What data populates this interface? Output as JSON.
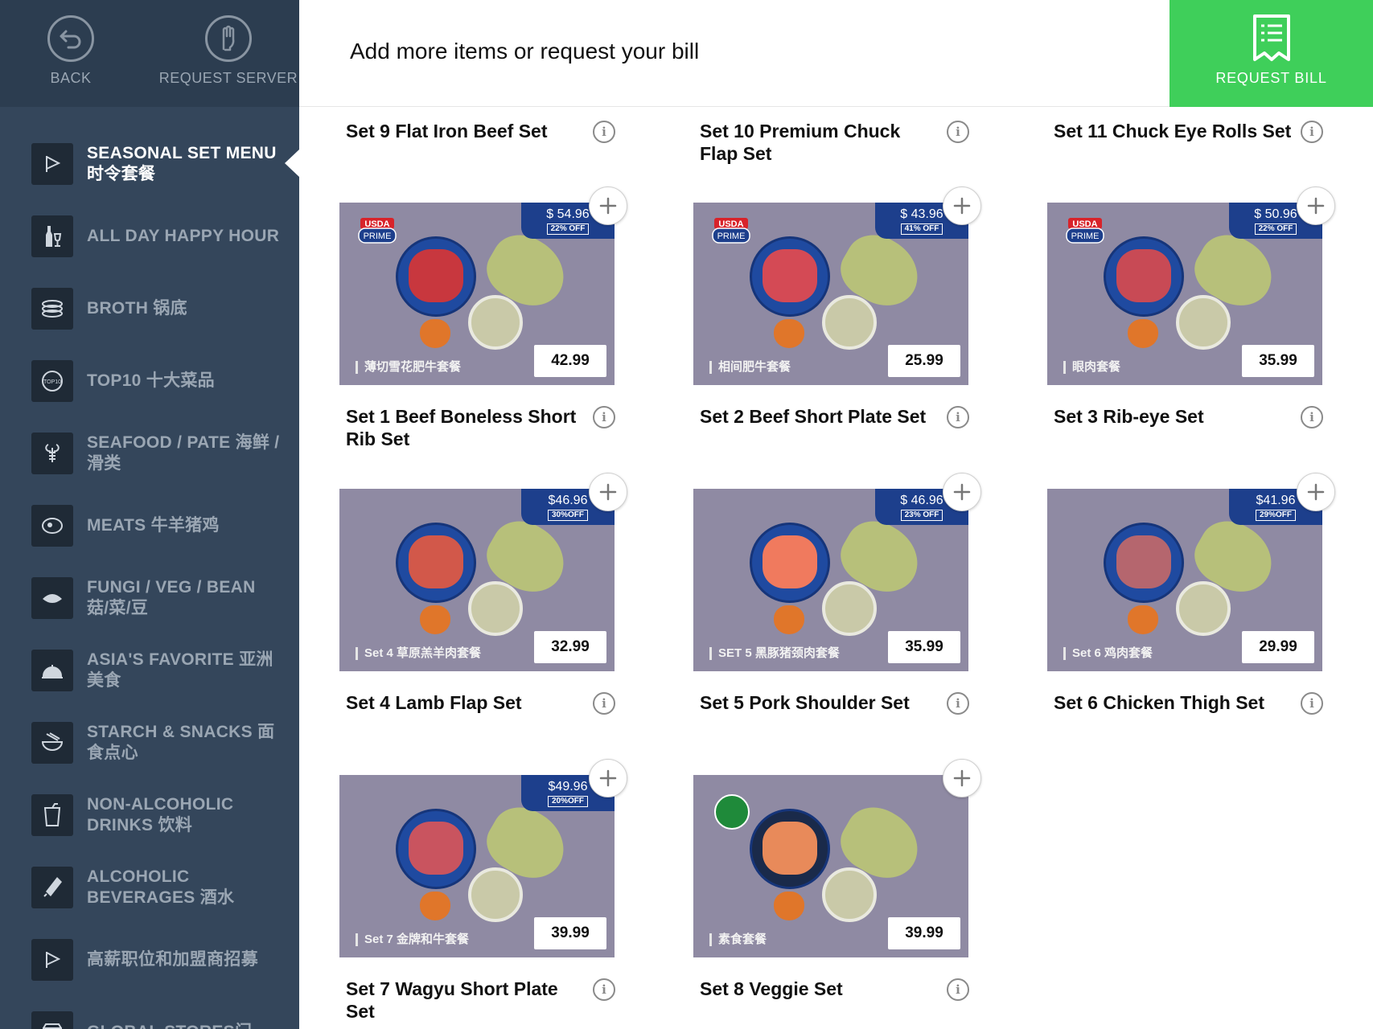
{
  "top_buttons": {
    "back": "BACK",
    "request_server": "REQUEST SERVER"
  },
  "header": {
    "message": "Add more items or request your bill",
    "request_bill": "REQUEST BILL"
  },
  "categories": [
    {
      "label": "SEASONAL SET MENU 时令套餐",
      "icon": "flag-icon",
      "active": true
    },
    {
      "label": "ALL DAY HAPPY HOUR",
      "icon": "bottle-glass-icon"
    },
    {
      "label": "BROTH 锅底",
      "icon": "pot-icon"
    },
    {
      "label": "TOP10 十大菜品",
      "icon": "top10-icon"
    },
    {
      "label": "SEAFOOD / PATE 海鲜 / 滑类",
      "icon": "lobster-icon"
    },
    {
      "label": "MEATS 牛羊猪鸡",
      "icon": "meat-icon"
    },
    {
      "label": "FUNGI / VEG / BEAN 菇/菜/豆",
      "icon": "leaf-icon"
    },
    {
      "label": "ASIA'S FAVORITE 亚洲美食",
      "icon": "cloche-icon"
    },
    {
      "label": "STARCH & SNACKS 面食点心",
      "icon": "noodle-bowl-icon"
    },
    {
      "label": "NON-ALCOHOLIC DRINKS 饮料",
      "icon": "cup-icon"
    },
    {
      "label": "ALCOHOLIC BEVERAGES 酒水",
      "icon": "champagne-icon"
    },
    {
      "label": "高薪职位和加盟商招募",
      "icon": "flag-icon"
    },
    {
      "label": "GLOBAL STORES门",
      "icon": "store-icon"
    }
  ],
  "top_row_titles": [
    "Set 9 Flat Iron Beef Set",
    "Set 10 Premium Chuck Flap Set",
    "Set 11 Chuck Eye Rolls Set"
  ],
  "items": [
    {
      "title": "Set 1 Beef Boneless Short Rib Set",
      "price": "42.99",
      "old_price": "$ 54.96",
      "off": "22% OFF",
      "cn": "薄切雪花肥牛套餐",
      "usda": true
    },
    {
      "title": "Set 2 Beef Short Plate Set",
      "price": "25.99",
      "old_price": "$ 43.96",
      "off": "41% OFF",
      "cn": "相间肥牛套餐",
      "usda": true
    },
    {
      "title": "Set 3 Rib-eye Set",
      "price": "35.99",
      "old_price": "$ 50.96",
      "off": "22% OFF",
      "cn": "眼肉套餐",
      "usda": true
    },
    {
      "title": "Set 4 Lamb Flap Set",
      "price": "32.99",
      "old_price": "$46.96",
      "off": "30%OFF",
      "cn": "Set 4 草原羔羊肉套餐",
      "usda": false
    },
    {
      "title": "Set 5 Pork Shoulder Set",
      "price": "35.99",
      "old_price": "$ 46.96",
      "off": "23% OFF",
      "cn": "SET 5 黑豚猪颈肉套餐",
      "usda": false
    },
    {
      "title": "Set 6 Chicken Thigh Set",
      "price": "29.99",
      "old_price": "$41.96",
      "off": "29%OFF",
      "cn": "Set 6 鸡肉套餐",
      "usda": false
    },
    {
      "title": "Set 7 Wagyu Short Plate Set",
      "price": "39.99",
      "old_price": "$49.96",
      "off": "20%OFF",
      "cn": "Set 7 金牌和牛套餐",
      "usda": false
    },
    {
      "title": "Set 8 Veggie Set",
      "price": "39.99",
      "old_price": "",
      "off": "",
      "cn": "素食套餐",
      "usda": false,
      "veggie": true
    }
  ],
  "colors": {
    "sidebar": "#34465b",
    "sidebar_top": "#2c3d50",
    "accent_green": "#3fcf5a",
    "card_bg": "#8f8aa3",
    "deal_blue": "#1d3f8c"
  }
}
